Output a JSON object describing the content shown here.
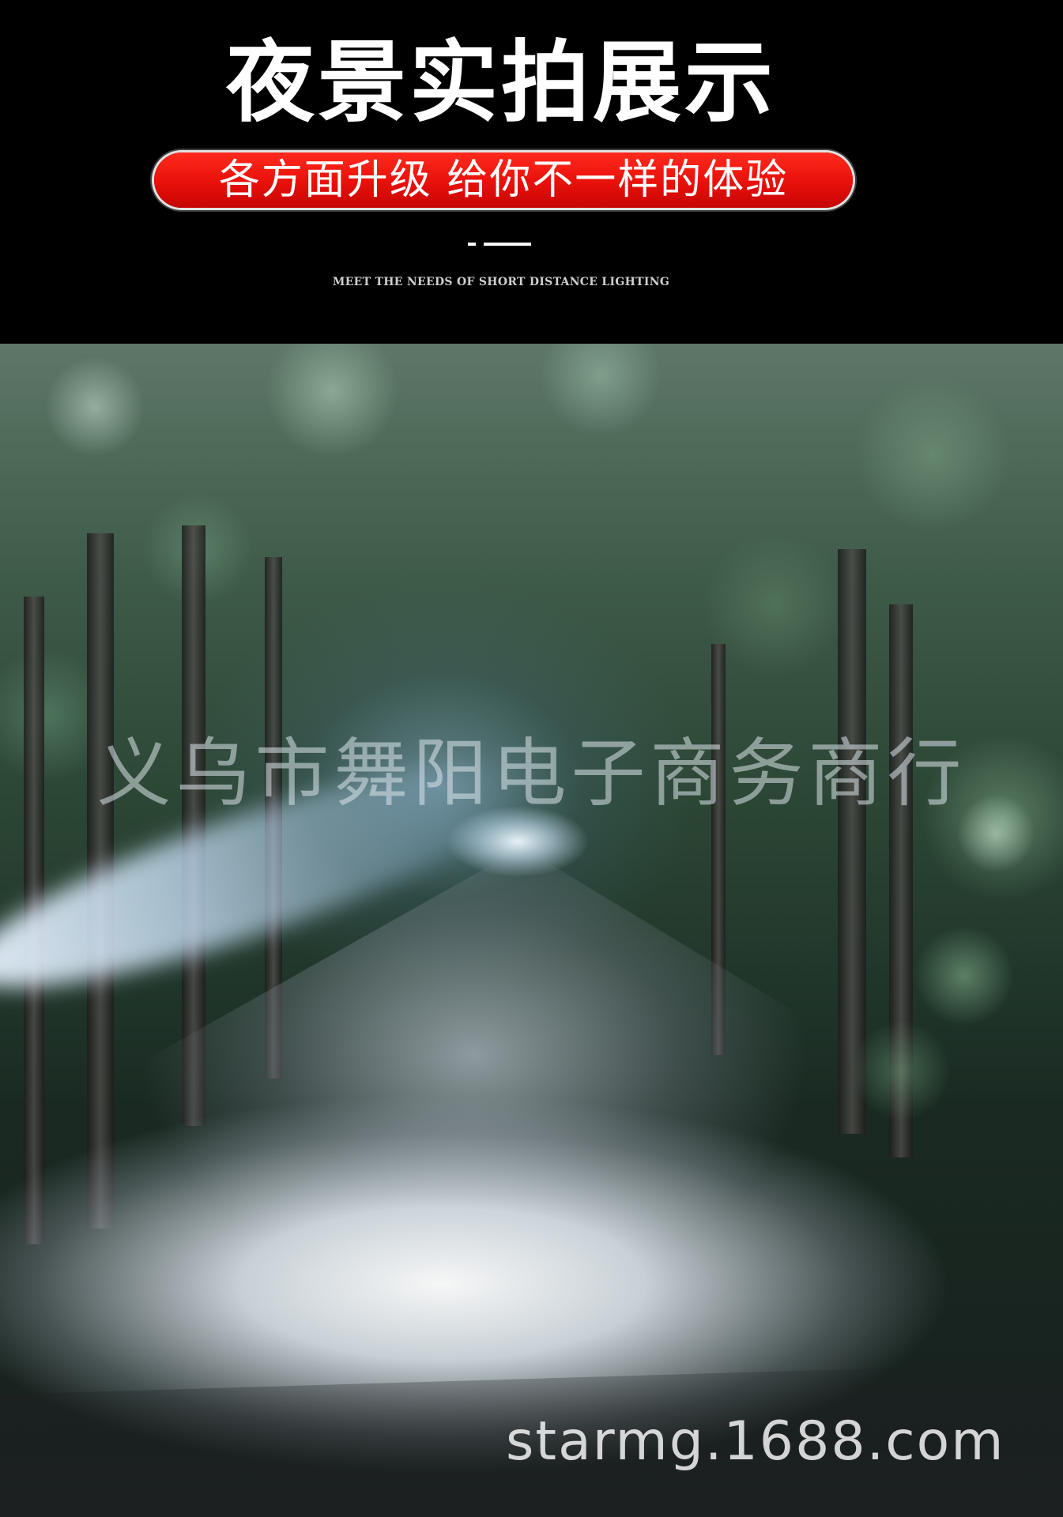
{
  "header": {
    "title": "夜景实拍展示",
    "banner": "各方面升级 给你不一样的体验",
    "subtitle": "MEET THE NEEDS OF SHORT DISTANCE LIGHTING"
  },
  "photo": {
    "watermark": "义乌市舞阳电子商务商行",
    "website": "starmg.1688.com"
  },
  "colors": {
    "background": "#000000",
    "banner_red": "#e8100a",
    "text": "#ffffff"
  }
}
